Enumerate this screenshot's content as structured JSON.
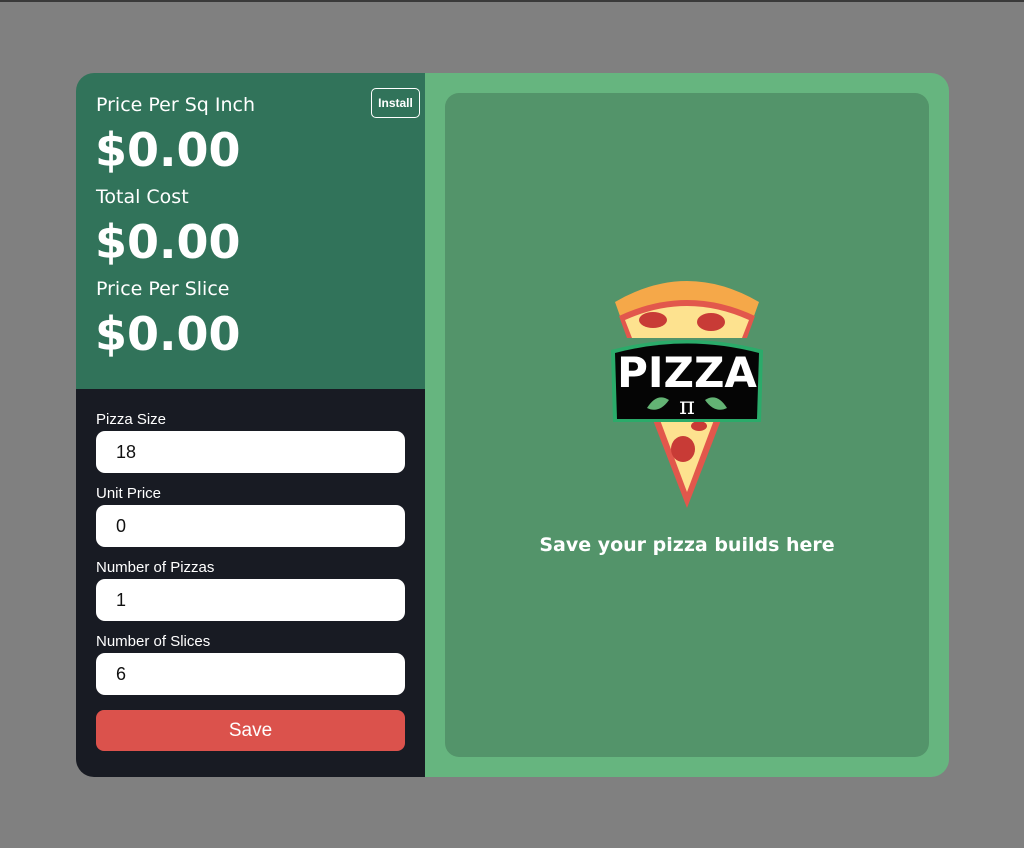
{
  "results": {
    "install_label": "Install",
    "price_per_sq_inch_label": "Price Per Sq Inch",
    "price_per_sq_inch_value": "$0.00",
    "total_cost_label": "Total Cost",
    "total_cost_value": "$0.00",
    "price_per_slice_label": "Price Per Slice",
    "price_per_slice_value": "$0.00"
  },
  "form": {
    "pizza_size_label": "Pizza Size",
    "pizza_size_value": "18",
    "unit_price_label": "Unit Price",
    "unit_price_value": "0",
    "num_pizzas_label": "Number of Pizzas",
    "num_pizzas_value": "1",
    "num_slices_label": "Number of Slices",
    "num_slices_value": "6",
    "save_label": "Save"
  },
  "saved": {
    "logo_text": "PIZZA",
    "logo_symbol": "π",
    "empty_message": "Save your pizza builds here"
  },
  "colors": {
    "results_bg": "#31735a",
    "form_bg": "#181b23",
    "save_button": "#db524c",
    "right_outer": "#66b57f",
    "right_inner": "#53946a"
  },
  "icons": {
    "logo": "pizza-slice-logo"
  }
}
